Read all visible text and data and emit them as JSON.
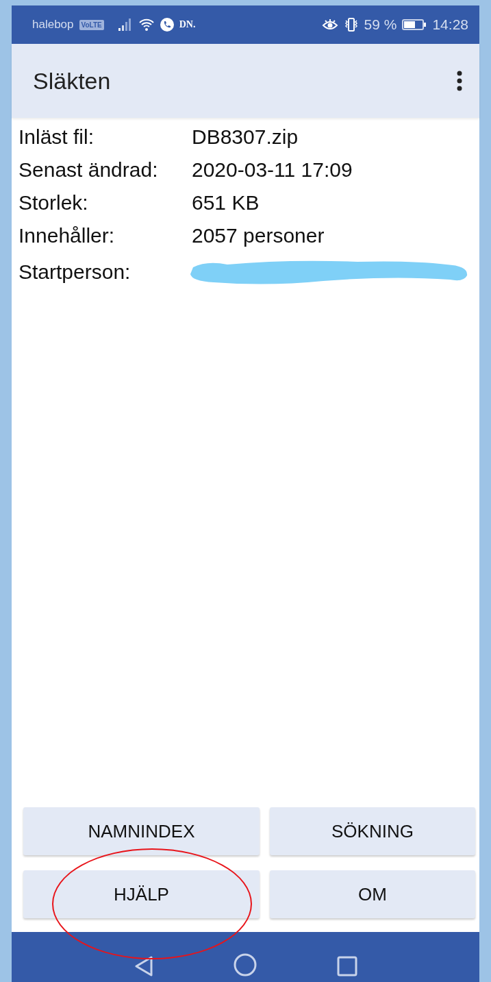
{
  "status_bar": {
    "carrier": "halebop",
    "volte": "VoLTE",
    "news": "DN.",
    "battery": "59 %",
    "time": "14:28"
  },
  "app_bar": {
    "title": "Släkten"
  },
  "info": [
    {
      "label": "Inläst fil:",
      "kind": "text",
      "value": "DB8307.zip"
    },
    {
      "label": "Senast ändrad:",
      "kind": "text",
      "value": "2020-03-11 17:09"
    },
    {
      "label": "Storlek:",
      "kind": "text",
      "value": "651 KB"
    },
    {
      "label": "Innehåller:",
      "kind": "text",
      "value": "2057 personer"
    },
    {
      "label": "Startperson:",
      "kind": "redacted"
    }
  ],
  "buttons": [
    {
      "label": "NAMNINDEX",
      "circled": false
    },
    {
      "label": "SÖKNING",
      "circled": false
    },
    {
      "label": "HJÄLP",
      "circled": true
    },
    {
      "label": "OM",
      "circled": false
    }
  ]
}
